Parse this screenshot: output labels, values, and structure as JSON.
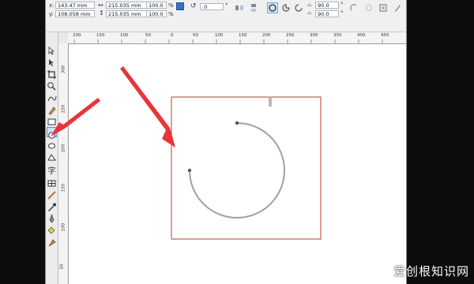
{
  "propbar": {
    "x_label": "x:",
    "x_value": "143.47 mm",
    "y_label": "y:",
    "y_value": "108.058 mm",
    "w_value": "215.035 mm",
    "h_value": "215.035 mm",
    "scale_x": "100.0",
    "scale_y": "100.0",
    "percent": "%",
    "rotate_value": ".0",
    "degree": "°",
    "start_angle": "90.0",
    "end_angle": "90.0"
  },
  "ruler": {
    "top_ticks": [
      "200",
      "150",
      "100",
      "50",
      "0",
      "50",
      "100",
      "150",
      "200",
      "250",
      "300",
      "350",
      "400",
      "450"
    ],
    "left_ticks": [
      "300",
      "250",
      "200",
      "150",
      "100",
      "50"
    ]
  },
  "toolbox": {
    "tools": [
      "pick-tool-icon",
      "shape-tool-icon",
      "crop-tool-icon",
      "zoom-tool-icon",
      "freehand-tool-icon",
      "smart-fill-icon",
      "rectangle-tool-icon",
      "ellipse-tool-icon",
      "polygon-tool-icon",
      "basic-shapes-icon",
      "text-tool-icon",
      "table-tool-icon",
      "dimension-tool-icon",
      "eyedropper-tool-icon",
      "outline-pen-icon",
      "fill-tool-icon",
      "interactive-fill-icon"
    ]
  },
  "colors": {
    "arrow": "#e8343a",
    "selection": "#c0392b",
    "arc": "#a0a0a0",
    "active_tool": "#cfe3f8"
  },
  "watermark": "爱创根知识网"
}
